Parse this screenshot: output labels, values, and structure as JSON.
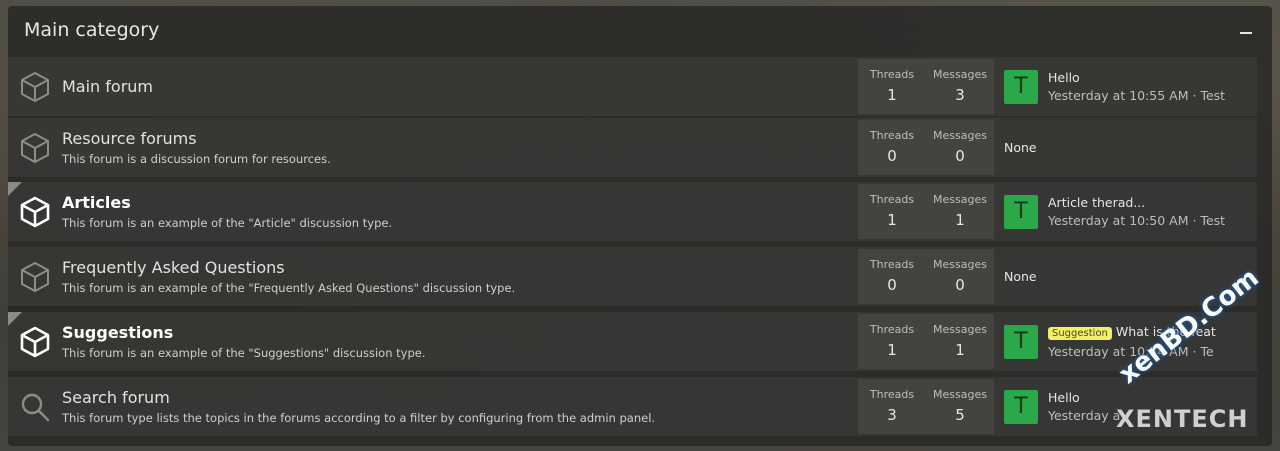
{
  "category": {
    "title": "Main category"
  },
  "stat_labels": {
    "threads": "Threads",
    "messages": "Messages"
  },
  "nodes": [
    {
      "title": "Main forum",
      "description": "",
      "unread": false,
      "icon": "cube-icon",
      "threads": "1",
      "messages": "3",
      "last": {
        "avatar": "T",
        "prefix": "",
        "title": "Hello",
        "meta": "Yesterday at 10:55 AM · Test"
      }
    },
    {
      "title": "Resource forums",
      "description": "This forum is a discussion forum for resources.",
      "unread": false,
      "icon": "cube-icon",
      "threads": "0",
      "messages": "0",
      "none": "None"
    },
    {
      "title": "Articles",
      "description": "This forum is an example of the \"Article\" discussion type.",
      "unread": true,
      "icon": "cube-icon",
      "threads": "1",
      "messages": "1",
      "last": {
        "avatar": "T",
        "prefix": "",
        "title": "Article therad...",
        "meta": "Yesterday at 10:50 AM · Test"
      }
    },
    {
      "title": "Frequently Asked Questions",
      "description": "This forum is an example of the \"Frequently Asked Questions\" discussion type.",
      "unread": false,
      "icon": "cube-icon",
      "threads": "0",
      "messages": "0",
      "none": "None"
    },
    {
      "title": "Suggestions",
      "description": "This forum is an example of the \"Suggestions\" discussion type.",
      "unread": true,
      "icon": "cube-icon",
      "threads": "1",
      "messages": "1",
      "last": {
        "avatar": "T",
        "prefix": "Suggestion",
        "title": "What is the feat",
        "meta": "Yesterday at 10:54 AM · Te"
      }
    },
    {
      "title": "Search forum",
      "description": "This forum type lists the topics in the forums according to a filter by configuring from the admin panel.",
      "unread": false,
      "icon": "search-icon",
      "threads": "3",
      "messages": "5",
      "last": {
        "avatar": "T",
        "prefix": "",
        "title": "Hello",
        "meta": "Yesterday a"
      }
    }
  ],
  "watermark": {
    "brand": "XENTECH",
    "site": "xenBD.Com"
  }
}
